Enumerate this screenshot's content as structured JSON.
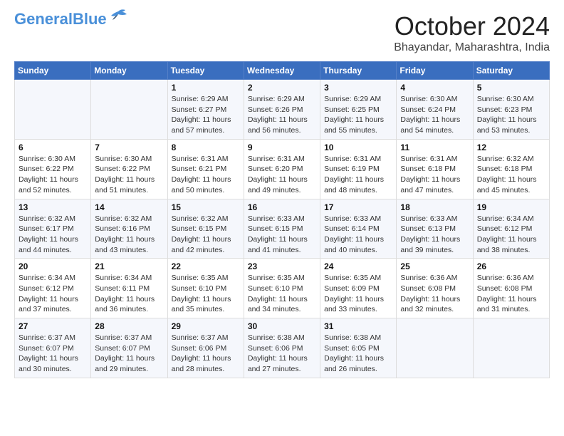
{
  "logo": {
    "line1": "General",
    "line2": "Blue"
  },
  "title": "October 2024",
  "subtitle": "Bhayandar, Maharashtra, India",
  "days_of_week": [
    "Sunday",
    "Monday",
    "Tuesday",
    "Wednesday",
    "Thursday",
    "Friday",
    "Saturday"
  ],
  "weeks": [
    [
      {
        "day": "",
        "info": ""
      },
      {
        "day": "",
        "info": ""
      },
      {
        "day": "1",
        "info": "Sunrise: 6:29 AM\nSunset: 6:27 PM\nDaylight: 11 hours and 57 minutes."
      },
      {
        "day": "2",
        "info": "Sunrise: 6:29 AM\nSunset: 6:26 PM\nDaylight: 11 hours and 56 minutes."
      },
      {
        "day": "3",
        "info": "Sunrise: 6:29 AM\nSunset: 6:25 PM\nDaylight: 11 hours and 55 minutes."
      },
      {
        "day": "4",
        "info": "Sunrise: 6:30 AM\nSunset: 6:24 PM\nDaylight: 11 hours and 54 minutes."
      },
      {
        "day": "5",
        "info": "Sunrise: 6:30 AM\nSunset: 6:23 PM\nDaylight: 11 hours and 53 minutes."
      }
    ],
    [
      {
        "day": "6",
        "info": "Sunrise: 6:30 AM\nSunset: 6:22 PM\nDaylight: 11 hours and 52 minutes."
      },
      {
        "day": "7",
        "info": "Sunrise: 6:30 AM\nSunset: 6:22 PM\nDaylight: 11 hours and 51 minutes."
      },
      {
        "day": "8",
        "info": "Sunrise: 6:31 AM\nSunset: 6:21 PM\nDaylight: 11 hours and 50 minutes."
      },
      {
        "day": "9",
        "info": "Sunrise: 6:31 AM\nSunset: 6:20 PM\nDaylight: 11 hours and 49 minutes."
      },
      {
        "day": "10",
        "info": "Sunrise: 6:31 AM\nSunset: 6:19 PM\nDaylight: 11 hours and 48 minutes."
      },
      {
        "day": "11",
        "info": "Sunrise: 6:31 AM\nSunset: 6:18 PM\nDaylight: 11 hours and 47 minutes."
      },
      {
        "day": "12",
        "info": "Sunrise: 6:32 AM\nSunset: 6:18 PM\nDaylight: 11 hours and 45 minutes."
      }
    ],
    [
      {
        "day": "13",
        "info": "Sunrise: 6:32 AM\nSunset: 6:17 PM\nDaylight: 11 hours and 44 minutes."
      },
      {
        "day": "14",
        "info": "Sunrise: 6:32 AM\nSunset: 6:16 PM\nDaylight: 11 hours and 43 minutes."
      },
      {
        "day": "15",
        "info": "Sunrise: 6:32 AM\nSunset: 6:15 PM\nDaylight: 11 hours and 42 minutes."
      },
      {
        "day": "16",
        "info": "Sunrise: 6:33 AM\nSunset: 6:15 PM\nDaylight: 11 hours and 41 minutes."
      },
      {
        "day": "17",
        "info": "Sunrise: 6:33 AM\nSunset: 6:14 PM\nDaylight: 11 hours and 40 minutes."
      },
      {
        "day": "18",
        "info": "Sunrise: 6:33 AM\nSunset: 6:13 PM\nDaylight: 11 hours and 39 minutes."
      },
      {
        "day": "19",
        "info": "Sunrise: 6:34 AM\nSunset: 6:12 PM\nDaylight: 11 hours and 38 minutes."
      }
    ],
    [
      {
        "day": "20",
        "info": "Sunrise: 6:34 AM\nSunset: 6:12 PM\nDaylight: 11 hours and 37 minutes."
      },
      {
        "day": "21",
        "info": "Sunrise: 6:34 AM\nSunset: 6:11 PM\nDaylight: 11 hours and 36 minutes."
      },
      {
        "day": "22",
        "info": "Sunrise: 6:35 AM\nSunset: 6:10 PM\nDaylight: 11 hours and 35 minutes."
      },
      {
        "day": "23",
        "info": "Sunrise: 6:35 AM\nSunset: 6:10 PM\nDaylight: 11 hours and 34 minutes."
      },
      {
        "day": "24",
        "info": "Sunrise: 6:35 AM\nSunset: 6:09 PM\nDaylight: 11 hours and 33 minutes."
      },
      {
        "day": "25",
        "info": "Sunrise: 6:36 AM\nSunset: 6:08 PM\nDaylight: 11 hours and 32 minutes."
      },
      {
        "day": "26",
        "info": "Sunrise: 6:36 AM\nSunset: 6:08 PM\nDaylight: 11 hours and 31 minutes."
      }
    ],
    [
      {
        "day": "27",
        "info": "Sunrise: 6:37 AM\nSunset: 6:07 PM\nDaylight: 11 hours and 30 minutes."
      },
      {
        "day": "28",
        "info": "Sunrise: 6:37 AM\nSunset: 6:07 PM\nDaylight: 11 hours and 29 minutes."
      },
      {
        "day": "29",
        "info": "Sunrise: 6:37 AM\nSunset: 6:06 PM\nDaylight: 11 hours and 28 minutes."
      },
      {
        "day": "30",
        "info": "Sunrise: 6:38 AM\nSunset: 6:06 PM\nDaylight: 11 hours and 27 minutes."
      },
      {
        "day": "31",
        "info": "Sunrise: 6:38 AM\nSunset: 6:05 PM\nDaylight: 11 hours and 26 minutes."
      },
      {
        "day": "",
        "info": ""
      },
      {
        "day": "",
        "info": ""
      }
    ]
  ]
}
